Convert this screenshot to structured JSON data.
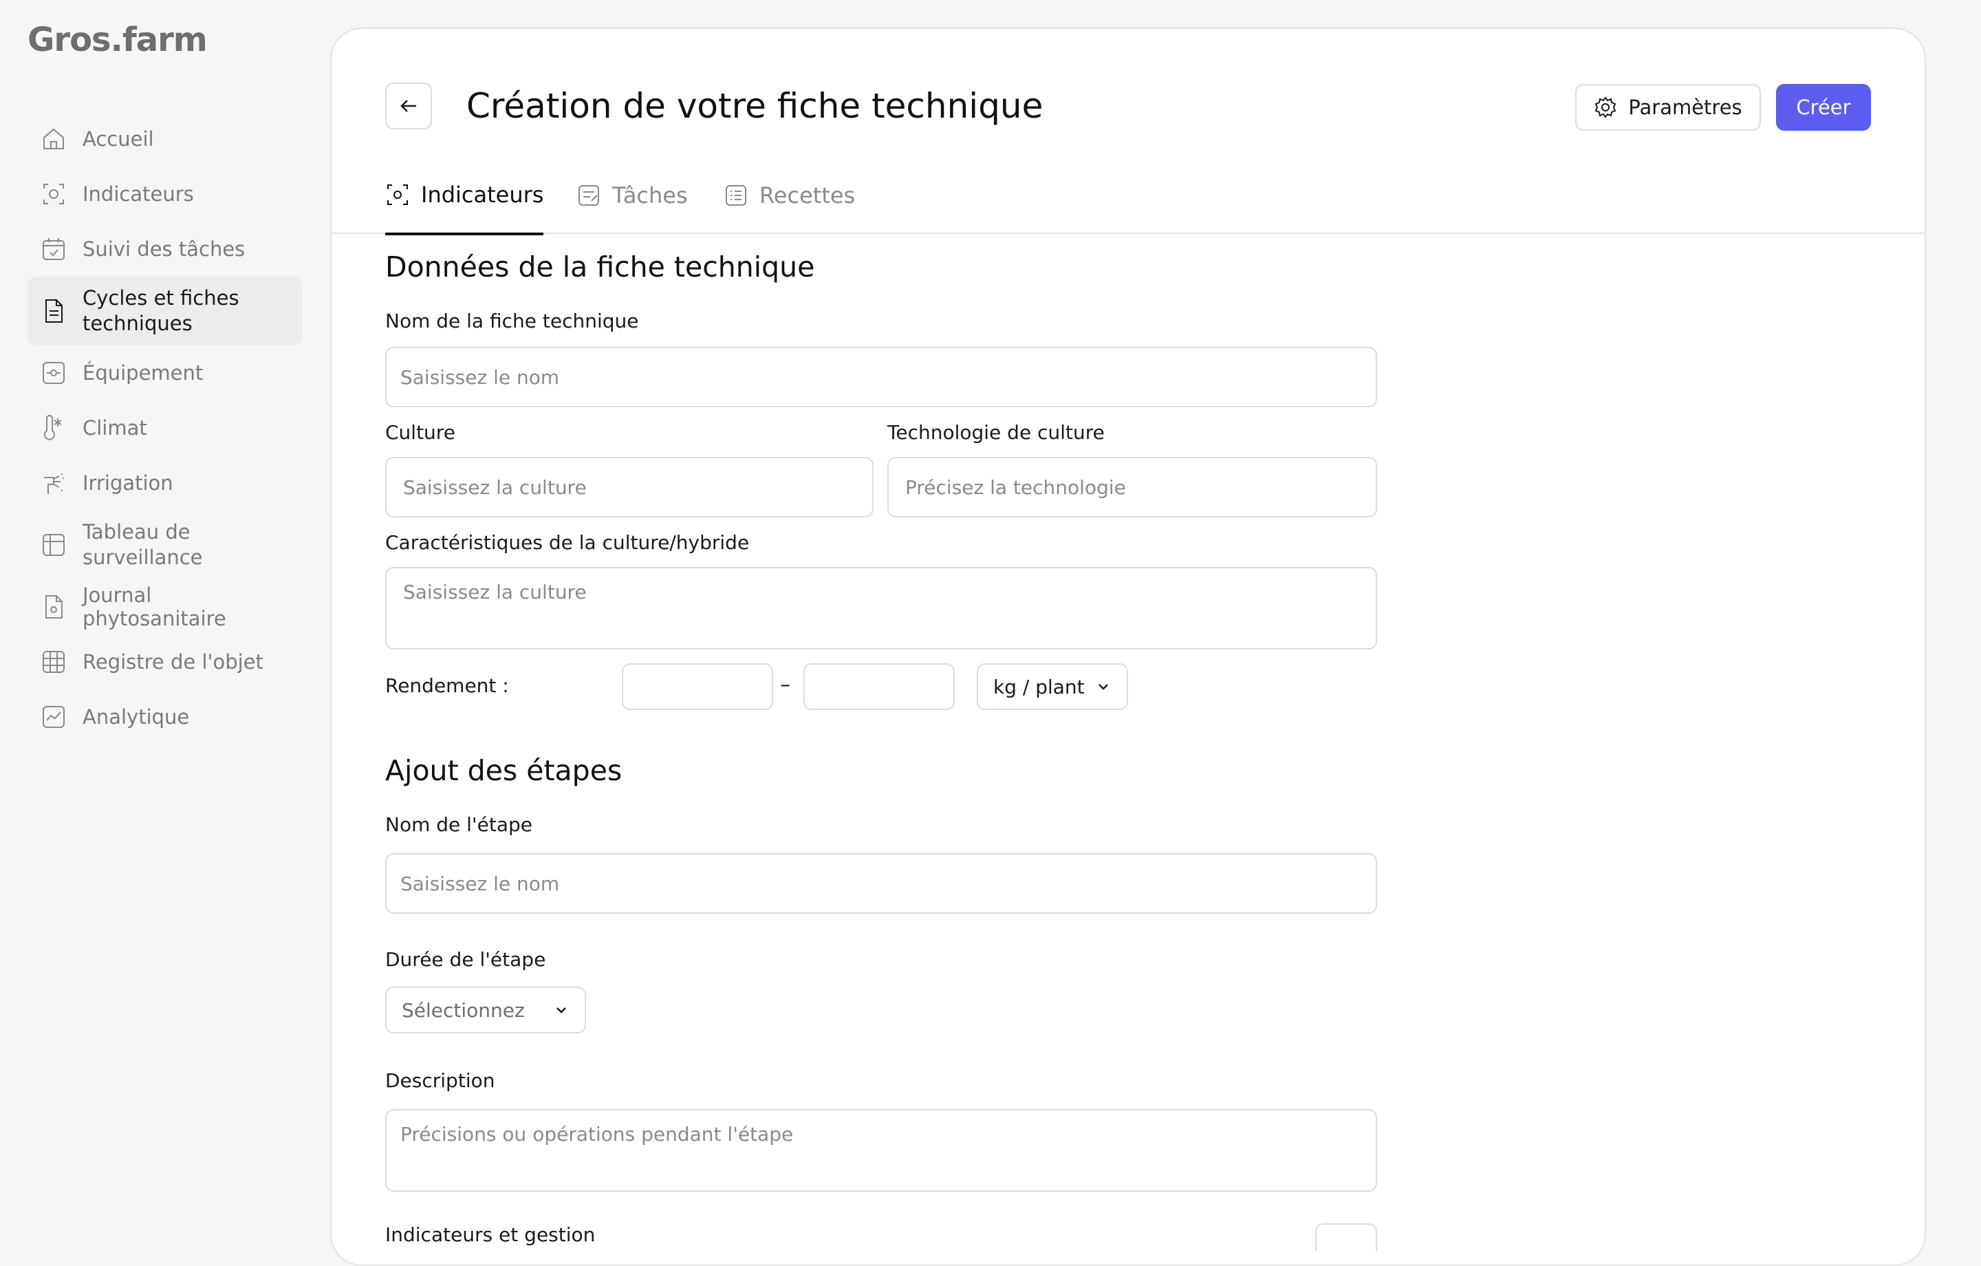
{
  "app": {
    "logo": "Gros.farm"
  },
  "sidebar": {
    "items": [
      {
        "label": "Accueil",
        "icon": "home-icon"
      },
      {
        "label": "Indicateurs",
        "icon": "sensor-icon"
      },
      {
        "label": "Suivi des tâches",
        "icon": "calendar-check-icon"
      },
      {
        "label": "Cycles et fiches techniques",
        "icon": "document-icon",
        "active": true
      },
      {
        "label": "Équipement",
        "icon": "equipment-icon"
      },
      {
        "label": "Climat",
        "icon": "thermometer-icon"
      },
      {
        "label": "Irrigation",
        "icon": "irrigation-icon"
      },
      {
        "label": "Tableau de surveillance",
        "icon": "table-icon"
      },
      {
        "label": "Journal phytosanitaire",
        "icon": "phyto-journal-icon"
      },
      {
        "label": "Registre de l'objet",
        "icon": "grid-icon"
      },
      {
        "label": "Analytique",
        "icon": "analytics-icon"
      }
    ]
  },
  "header": {
    "title": "Création de votre fiche technique",
    "params_label": "Paramètres",
    "create_label": "Créer"
  },
  "tabs": [
    {
      "label": "Indicateurs",
      "active": true
    },
    {
      "label": "Tâches"
    },
    {
      "label": "Recettes"
    }
  ],
  "form": {
    "section_data": "Données de la fiche technique",
    "name_label": "Nom de la fiche technique",
    "name_placeholder": "Saisissez le nom",
    "culture_label": "Culture",
    "culture_placeholder": "Saisissez la culture",
    "tech_label": "Technologie de culture",
    "tech_placeholder": "Précisez la technologie",
    "traits_label": "Caractéristiques de la culture/hybride",
    "traits_placeholder": "Saisissez la culture",
    "yield_label": "Rendement :",
    "yield_min": "",
    "yield_max": "",
    "yield_separator": "–",
    "yield_unit": "kg / plant",
    "section_steps": "Ajout des étapes",
    "step_name_label": "Nom de l'étape",
    "step_name_placeholder": "Saisissez le nom",
    "duration_label": "Durée de l'étape",
    "duration_value": "Sélectionnez",
    "description_label": "Description",
    "description_placeholder": "Précisions ou opérations pendant l'étape",
    "indicators_label": "Indicateurs et gestion"
  },
  "colors": {
    "accent": "#5b5ef0",
    "active_nav_bg": "#ececec"
  }
}
